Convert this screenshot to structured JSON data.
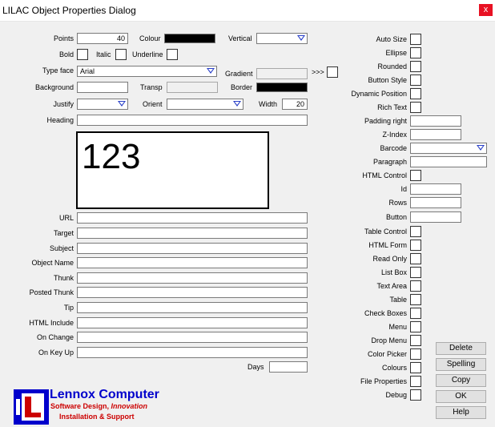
{
  "window": {
    "title": "LILAC Object Properties Dialog",
    "close_label": "x"
  },
  "left": {
    "points_label": "Points",
    "points_value": "40",
    "colour_label": "Colour",
    "vertical_label": "Vertical",
    "vertical_value": "",
    "bold_label": "Bold",
    "italic_label": "Italic",
    "underline_label": "Underline",
    "typeface_label": "Type face",
    "typeface_value": "Arial",
    "gradient_label": "Gradient",
    "gradient_arrow": ">>>",
    "background_label": "Background",
    "transp_label": "Transp",
    "border_label": "Border",
    "justify_label": "Justify",
    "orient_label": "Orient",
    "width_label": "Width",
    "width_value": "20",
    "heading_label": "Heading",
    "preview_text": "123",
    "fields": [
      {
        "label": "URL",
        "value": ""
      },
      {
        "label": "Target",
        "value": ""
      },
      {
        "label": "Subject",
        "value": ""
      },
      {
        "label": "Object Name",
        "value": ""
      },
      {
        "label": "Thunk",
        "value": ""
      },
      {
        "label": "Posted Thunk",
        "value": ""
      },
      {
        "label": "Tip",
        "value": ""
      },
      {
        "label": "HTML Include",
        "value": ""
      },
      {
        "label": "On Change",
        "value": ""
      },
      {
        "label": "On Key Up",
        "value": ""
      }
    ],
    "days_label": "Days"
  },
  "right": {
    "checkboxes_top": [
      "Auto Size",
      "Ellipse",
      "Rounded",
      "Button Style",
      "Dynamic Position",
      "Rich Text"
    ],
    "padding_right_label": "Padding right",
    "z_index_label": "Z-Index",
    "barcode_label": "Barcode",
    "paragraph_label": "Paragraph",
    "html_control_label": "HTML Control",
    "id_label": "Id",
    "rows_label": "Rows",
    "button_label": "Button",
    "checkboxes_bottom": [
      "Table Control",
      "HTML Form",
      "Read Only",
      "List Box",
      "Text Area",
      "Table",
      "Check Boxes",
      "Menu",
      "Drop Menu",
      "Color Picker",
      "Colours",
      "File Properties",
      "Debug"
    ]
  },
  "buttons": [
    "Delete",
    "Spelling",
    "Copy",
    "OK",
    "Help"
  ],
  "logo": {
    "company": "Lennox Computer",
    "tagline_a": "Software Design,",
    "tagline_b": "Innovation",
    "tagline_2": "Installation & Support"
  },
  "colors": {
    "logo_blue": "#0000cc",
    "logo_red": "#cc0000",
    "close_red": "#e81123",
    "arrow_blue": "#2a40c8"
  }
}
